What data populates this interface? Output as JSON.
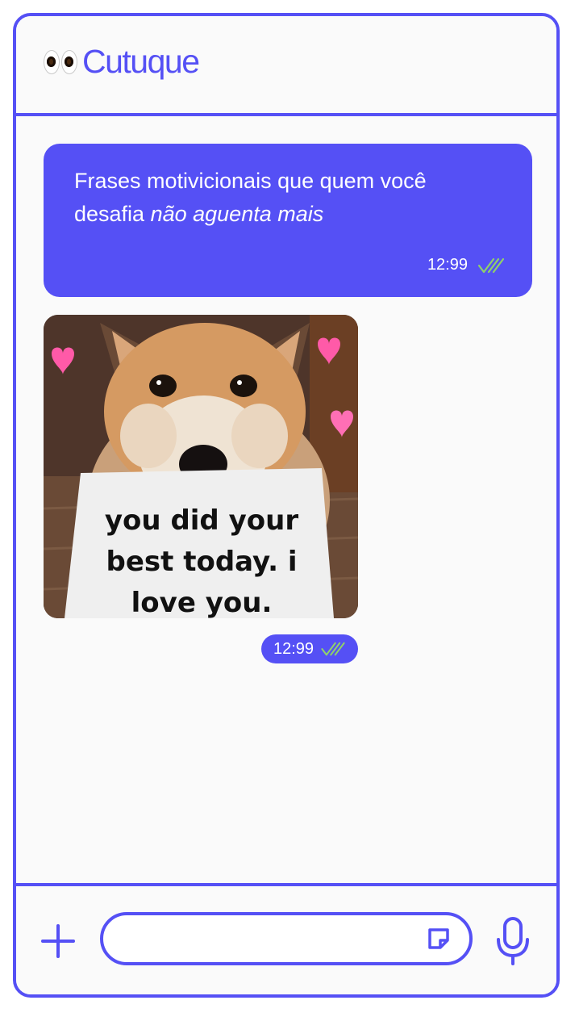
{
  "app": {
    "title": "Cutuque",
    "logo_icon": "eyes-icon",
    "accent_color": "#5550f5",
    "check_color": "#8fd16a"
  },
  "messages": [
    {
      "type": "text",
      "text_plain": "Frases motivicionais que quem você desafia ",
      "text_italic": "não aguenta mais",
      "time": "12:99",
      "status_icon": "double-check-icon"
    },
    {
      "type": "image",
      "image_icon": "shiba-dog-sign-image",
      "sign_text": "you did your best today. i love you.",
      "time": "12:99",
      "status_icon": "double-check-icon"
    }
  ],
  "composer": {
    "plus_icon": "plus-icon",
    "input_value": "",
    "input_placeholder": "",
    "sticker_icon": "sticker-icon",
    "mic_icon": "microphone-icon"
  }
}
